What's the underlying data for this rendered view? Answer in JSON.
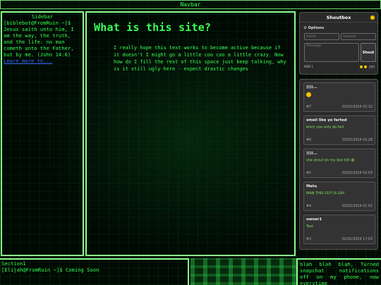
{
  "navbar": {
    "title": "Navbar"
  },
  "sidebar": {
    "title": "Sidebar",
    "text": "[biblebot@FromRuin ~]$ Jesus saith unto him, I am the way, the truth, and the life: no man cometh unto the Father, but by me. (John 14:6)",
    "link": "Learn more to..."
  },
  "main": {
    "heading": "What is this site?",
    "paragraph": "I really hope this text works to become active because if it doesn't I might go a little coo coo a little crazy. Now how do I fill the rest of this space just keep talking, why is it still ugly here - expect drastic changes"
  },
  "section1": {
    "title": "Section1",
    "text": "[Elijah@FromRuin ~]$ Coming Soon"
  },
  "section2": {
    "text": "blah blah blah, Turned snapchat notifications off on my phone, now everytime"
  },
  "shoutbox": {
    "title": "Shoutbox",
    "options_label": "Options",
    "name_placeholder": "Name",
    "website_placeholder": "Website",
    "message_placeholder": "Message",
    "shout_label": "Shout",
    "footer_left": "BBB 1",
    "footer_right": "200"
  },
  "messages": [
    {
      "author": "))))...",
      "text": "",
      "num": "#7",
      "time": "03/02/2024 02:32",
      "emoji": true
    },
    {
      "author": "smell like yo farted",
      "text": "bitch you only do fart",
      "num": "#6",
      "time": "03/02/2024 02:28",
      "emoji": false
    },
    {
      "author": "))))...",
      "text": "she shout on my box tilll 😭",
      "num": "#5",
      "time": "03/02/2024 02:03",
      "emoji": false
    },
    {
      "author": "Matu",
      "text": "MAN THIS GUY IS GAY",
      "num": "#4",
      "time": "03/02/2024 01:01",
      "emoji": false
    },
    {
      "author": "owner1",
      "text": "Test",
      "num": "#3",
      "time": "02/02/2024 17:03",
      "emoji": false
    }
  ],
  "colors": {
    "accent": "#2aff4a",
    "border": "#8dff8d",
    "panel": "#2a2a2a"
  }
}
